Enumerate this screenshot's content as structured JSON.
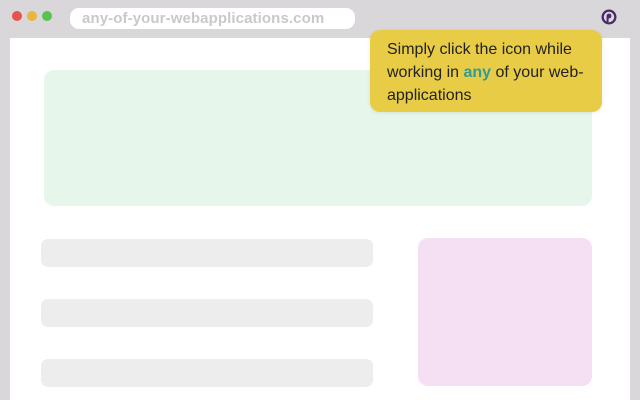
{
  "window": {
    "traffic_lights": {
      "close_color": "#e8534a",
      "minimize_color": "#e9b53a",
      "maximize_color": "#58c24f"
    },
    "address_bar": {
      "url": "any-of-your-webapplications.com"
    },
    "extension_icon": "extension-logo-icon"
  },
  "tooltip": {
    "text_before": "Simply click the icon while working in ",
    "highlight": "any",
    "text_after": " of your web-applications",
    "background_color": "#e8cc45",
    "highlight_color": "#2f9c97"
  },
  "colors": {
    "hero_placeholder": "#e7f6ea",
    "side_placeholder": "#f5dff3",
    "row_placeholder": "#ededed"
  }
}
